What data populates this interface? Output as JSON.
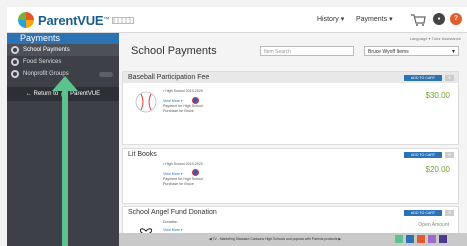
{
  "header": {
    "logo_text": "ParentVUE",
    "logo_tm": "™",
    "nav_history": "History ▾",
    "nav_payments": "Payments ▾",
    "help_label": "?"
  },
  "sidebar": {
    "title": "Payments",
    "items": [
      {
        "label": "School Payments"
      },
      {
        "label": "Food Services"
      },
      {
        "label": "Nonprofit Groups"
      }
    ],
    "return_prefix": "← Return to",
    "return_brand": "ParentVUE"
  },
  "main": {
    "language_link": "Language ▾  Tutor Assistance",
    "page_title": "School Payments",
    "search_placeholder": "Item Search",
    "student_select": "Bruce Wyoff Items",
    "cart_button": "ADD TO CART",
    "view_more": "View More ▾",
    "items": [
      {
        "title": "Baseball Participation Fee",
        "school": "• High School 2019-2020",
        "payment_for": "Payment for High School",
        "purchase_for": "Purchase for Bruce",
        "price": "$30.00"
      },
      {
        "title": "Lit Books",
        "school": "• High School 2019-2020",
        "payment_for": "Payment for High School",
        "purchase_for": "Purchase for Bruce",
        "price": "$20.00"
      },
      {
        "title": "School Angel Fund Donation",
        "school": "Donation",
        "payment_for": "Payment for Synergy Demo District 2020",
        "amount_label": "Open Amount"
      }
    ]
  },
  "bottom_band": {
    "text": "◀  TV - Marketing Standard Cartoons High Schools and popular with Parents products  ▶"
  },
  "colors": {
    "accent": "#2b73b4",
    "sidebar_bg": "#3d4047",
    "price_green": "#74a83a",
    "arrow_green": "#5cc290"
  }
}
